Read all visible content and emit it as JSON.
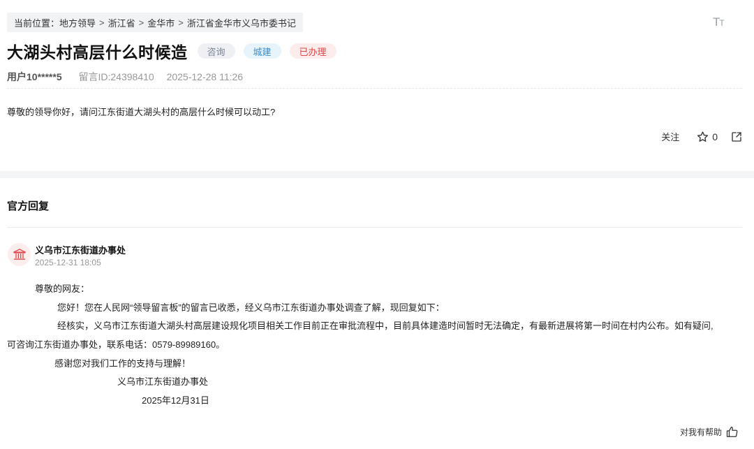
{
  "breadcrumb": {
    "prefix": "当前位置：",
    "items": [
      "地方领导",
      "浙江省",
      "金华市",
      "浙江省金华市义乌市委书记"
    ],
    "separator": ">"
  },
  "font_toggle": {
    "big": "T",
    "small": "T"
  },
  "message": {
    "title": "大湖头村高层什么时候造",
    "tags": {
      "type": "咨询",
      "domain": "城建",
      "status": "已办理"
    },
    "user": "用户10*****5",
    "message_id": "留言ID:24398410",
    "datetime": "2025-12-28 11:26",
    "content": "尊敬的领导你好，请问江东街道大湖头村的高层什么时候可以动工?"
  },
  "actions": {
    "follow_label": "关注",
    "star_count": "0",
    "icons": [
      "star-outline-icon",
      "share-icon"
    ]
  },
  "reply": {
    "heading": "官方回复",
    "org_name": "义乌市江东街道办事处",
    "org_time": "2025-12-31 18:05",
    "avatar_icon": "government-building-icon",
    "lines": [
      "尊敬的网友：",
      "您好！您在人民网“领导留言板”的留言已收悉，经义乌市江东街道办事处调查了解，现回复如下：",
      "经核实，义乌市江东街道大湖头村高层建设规化项目相关工作目前正在审批流程中，目前具体建造时间暂时无法确定，有最新进展将第一时间在村内公布。如有疑问,",
      "可咨询江东街道办事处，联系电话：0579-89989160。",
      "感谢您对我们工作的支持与理解！",
      "义乌市江东街道办事处",
      "2025年12月31日"
    ],
    "helpful_label": "对我有帮助"
  },
  "colors": {
    "tag_consult_text": "#7b8494",
    "tag_build_text": "#3a8ed0",
    "tag_done_text": "#e0464a",
    "avatar_icon": "#e0464a"
  }
}
